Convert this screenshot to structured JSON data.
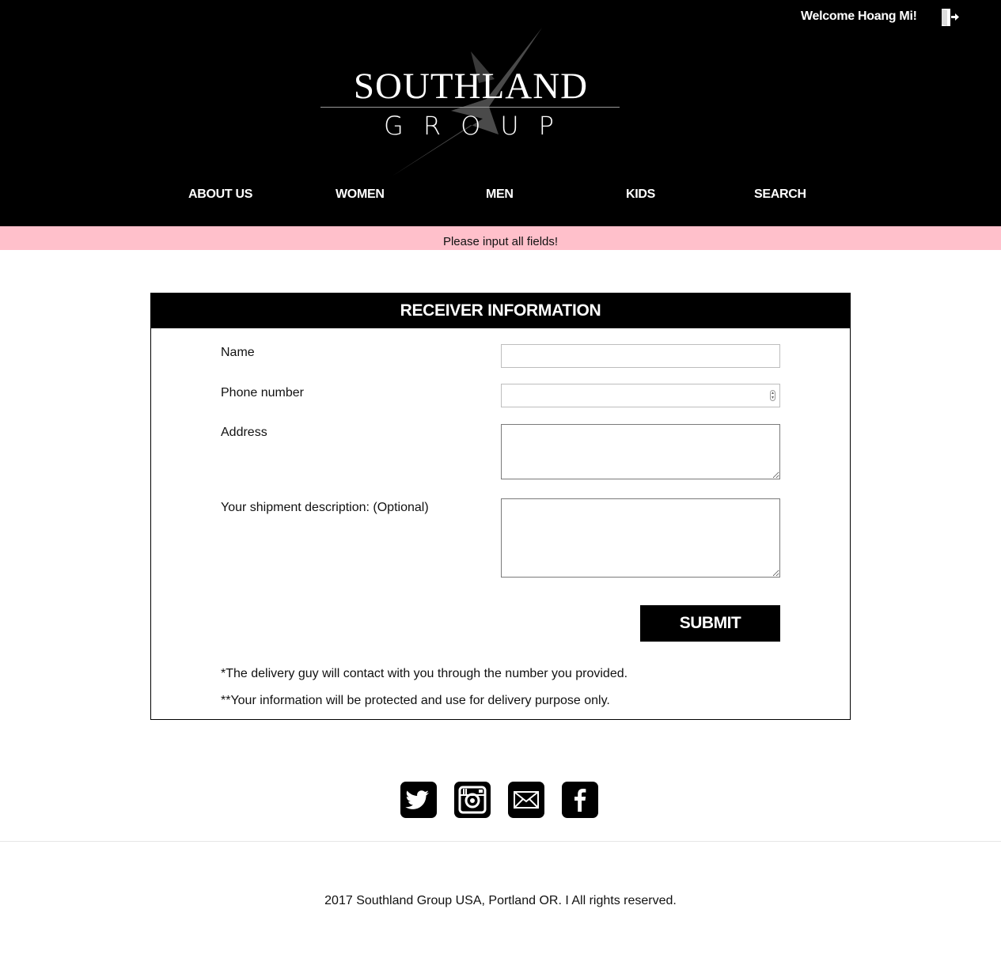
{
  "header": {
    "welcome_text": "Welcome Hoang Mi!",
    "logo": {
      "brand": "SOUTHLAND",
      "sub": "GROUP"
    },
    "nav": [
      "ABOUT US",
      "WOMEN",
      "MEN",
      "KIDS",
      "SEARCH"
    ]
  },
  "alert": {
    "message": "Please input all fields!",
    "color": "#ffc0cb"
  },
  "form": {
    "title": "RECEIVER INFORMATION",
    "fields": {
      "name": {
        "label": "Name",
        "value": ""
      },
      "phone": {
        "label": "Phone number",
        "value": ""
      },
      "address": {
        "label": "Address",
        "value": ""
      },
      "description": {
        "label": "Your shipment description: (Optional)",
        "value": ""
      }
    },
    "submit_label": "SUBMIT",
    "notes": [
      "*The delivery guy will contact with you through the number you provided.",
      "**Your information will be protected and use for delivery purpose only."
    ]
  },
  "social": [
    "twitter-icon",
    "instagram-icon",
    "mail-icon",
    "facebook-icon"
  ],
  "footer": {
    "copyright": "2017 Southland Group USA, Portland OR. I All rights reserved."
  }
}
